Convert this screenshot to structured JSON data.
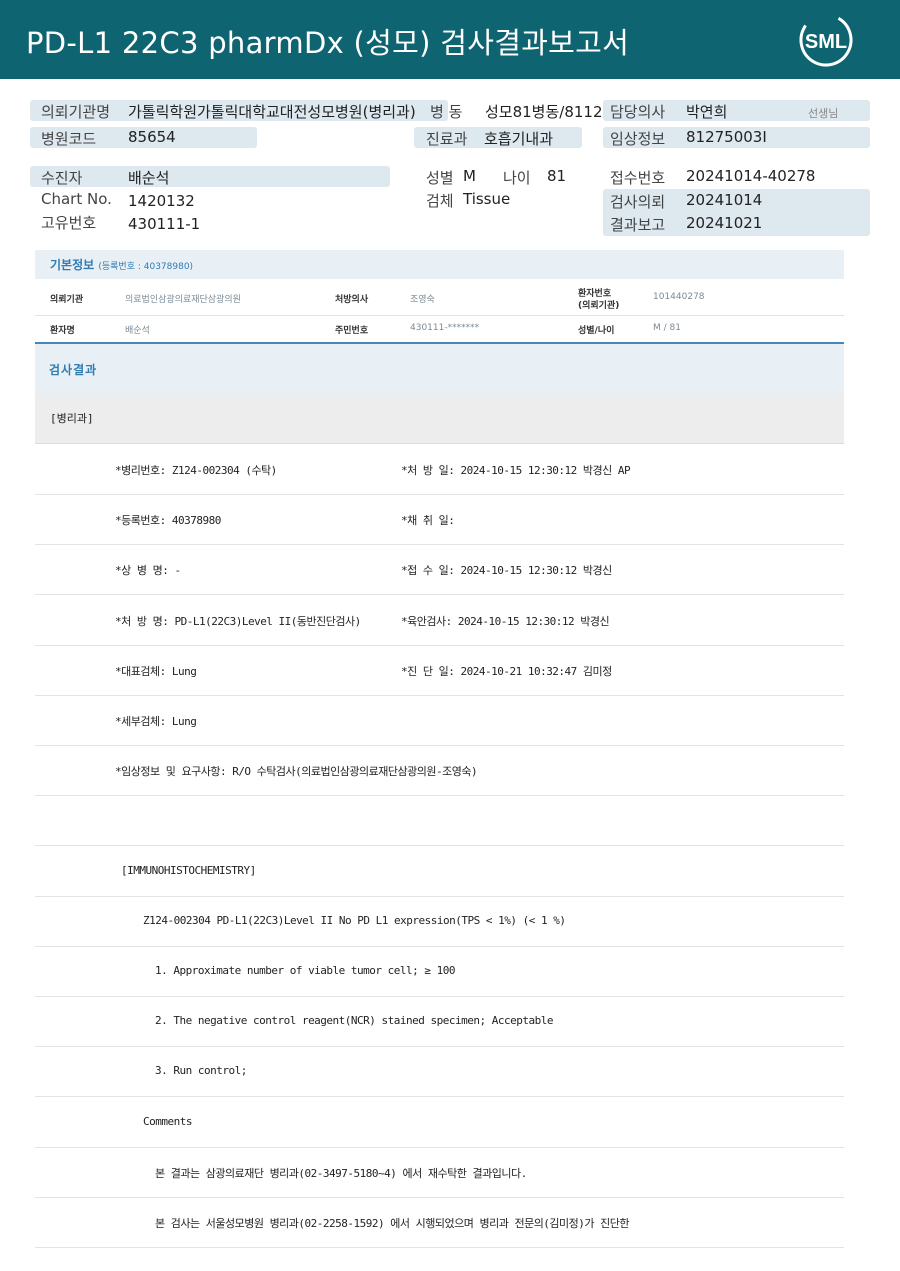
{
  "header": {
    "title": "PD-L1 22C3 pharmDx (성모) 검사결과보고서",
    "logo_text": "SML"
  },
  "top": {
    "inst_label": "의뢰기관명",
    "inst_value": "가톨릭학원가톨릭대학교대전성모병원(병리과)",
    "ward_label": "병  동",
    "ward_value": "성모81병동/8112",
    "doctor_label": "담당의사",
    "doctor_value": "박연희",
    "doctor_suffix": "선생님",
    "hosp_code_label": "병원코드",
    "hosp_code_value": "85654",
    "dept_label": "진료과",
    "dept_value": "호흡기내과",
    "clinical_label": "임상정보",
    "clinical_value": "81275003I",
    "patient_label": "수진자",
    "patient_value": "배순석",
    "sex_label": "성별",
    "sex_value": "M",
    "age_label": "나이",
    "age_value": "81",
    "receipt_label": "접수번호",
    "receipt_value": "20241014-40278",
    "chart_label": "Chart No.",
    "chart_value": "1420132",
    "specimen_label": "검체",
    "specimen_value": "Tissue",
    "request_label": "검사의뢰",
    "request_value": "20241014",
    "uid_label": "고유번호",
    "uid_value": "430111-1",
    "report_label": "결과보고",
    "report_value": "20241021"
  },
  "basic": {
    "title": "기본정보",
    "reg_no": "(등록번호 : 40378980)",
    "inst_k": "의뢰기관",
    "inst_v": "의료법인삼광의료재단삼광의원",
    "doc_k": "처방의사",
    "doc_v": "조영숙",
    "pid_k1": "환자번호",
    "pid_k2": "(의뢰기관)",
    "pid_v": "101440278",
    "name_k": "환자명",
    "name_v": "배순석",
    "rrn_k": "주민번호",
    "rrn_v": "430111-*******",
    "sexage_k": "성별/나이",
    "sexage_v": "M / 81"
  },
  "results": {
    "title": "검사결과",
    "dept": "[병리과]",
    "rows": [
      {
        "left": "*병리번호: Z124-002304 (수탁)",
        "right": "*처 방 일: 2024-10-15 12:30:12  박경신 AP"
      },
      {
        "left": "*등록번호: 40378980",
        "right": "*채 취 일:"
      },
      {
        "left": "*상 병 명: -",
        "right": "*접 수 일: 2024-10-15 12:30:12  박경신"
      },
      {
        "left": "*처 방 명: PD-L1(22C3)Level II(동반진단검사)",
        "right": "*육안검사: 2024-10-15 12:30:12  박경신"
      },
      {
        "left": "*대표검체: Lung",
        "right": "*진 단 일: 2024-10-21 10:32:47  김미정"
      },
      {
        "left": "*세부검체: Lung",
        "right": ""
      },
      {
        "left": "*임상정보 및 요구사항: R/O 수탁검사(의료법인삼광의료재단삼광의원-조영숙)",
        "right": ""
      },
      {
        "left": "",
        "right": ""
      },
      {
        "left": "[IMMUNOHISTOCHEMISTRY]",
        "right": ""
      },
      {
        "left": "Z124-002304      PD-L1(22C3)Level II        No PD L1 expression(TPS < 1%) (< 1 %)",
        "right": ""
      },
      {
        "left": "1. Approximate number of viable tumor cell; ≥ 100",
        "right": ""
      },
      {
        "left": "2. The negative control reagent(NCR) stained specimen; Acceptable",
        "right": ""
      },
      {
        "left": "3. Run control;",
        "right": ""
      },
      {
        "left": "Comments",
        "right": ""
      },
      {
        "left": "본 결과는 삼광의료재단 병리과(02-3497-5180~4) 에서 재수탁한 결과입니다.",
        "right": ""
      },
      {
        "left": "본 검사는 서울성모병원 병리과(02-2258-1592) 에서 시행되었으며 병리과 전문의(김미정)가 진단한",
        "right": ""
      }
    ]
  },
  "colors": {
    "header_bg": "#0e6470",
    "label_bg": "#dde8ef",
    "accent": "#2f7cb3"
  }
}
